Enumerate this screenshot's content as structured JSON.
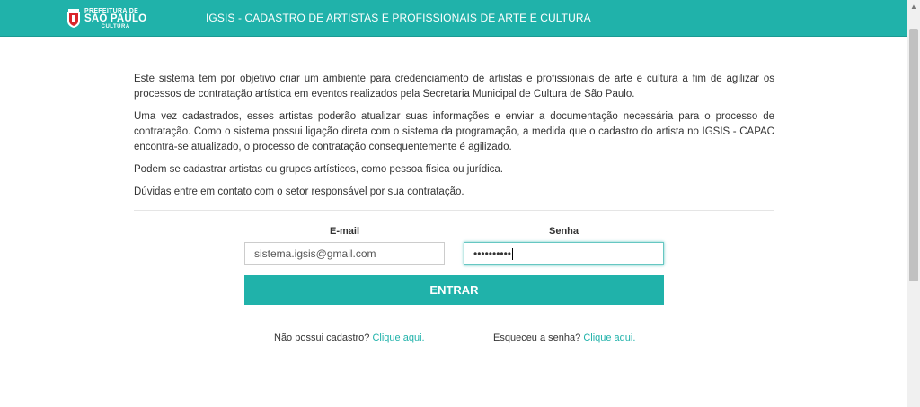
{
  "header": {
    "logo": {
      "line1": "PREFEITURA DE",
      "line2": "SÃO PAULO",
      "line3": "CULTURA"
    },
    "title": "IGSIS - CADASTRO DE ARTISTAS E PROFISSIONAIS DE ARTE E CULTURA"
  },
  "intro": {
    "p1": "Este sistema tem por objetivo criar um ambiente para credenciamento de artistas e profissionais de arte e cultura a fim de agilizar os processos de contratação artística em eventos realizados pela Secretaria Municipal de Cultura de São Paulo.",
    "p2": "Uma vez cadastrados, esses artistas poderão atualizar suas informações e enviar a documentação necessária para o processo de contratação. Como o sistema possui ligação direta com o sistema da programação, a medida que o cadastro do artista no IGSIS - CAPAC encontra-se atualizado, o processo de contratação consequentemente é agilizado.",
    "p3": "Podem se cadastrar artistas ou grupos artísticos, como pessoa física ou jurídica.",
    "p4": "Dúvidas entre em contato com o setor responsável por sua contratação."
  },
  "login": {
    "email_label": "E-mail",
    "email_value": "sistema.igsis@gmail.com",
    "password_label": "Senha",
    "password_masked": "••••••••••",
    "submit_label": "ENTRAR"
  },
  "links": {
    "register_prompt": "Não possui cadastro?",
    "register_link": "Clique aqui.",
    "forgot_prompt": "Esqueceu a senha?",
    "forgot_link": "Clique aqui."
  },
  "colors": {
    "brand": "#20b2aa",
    "text": "#333333"
  }
}
